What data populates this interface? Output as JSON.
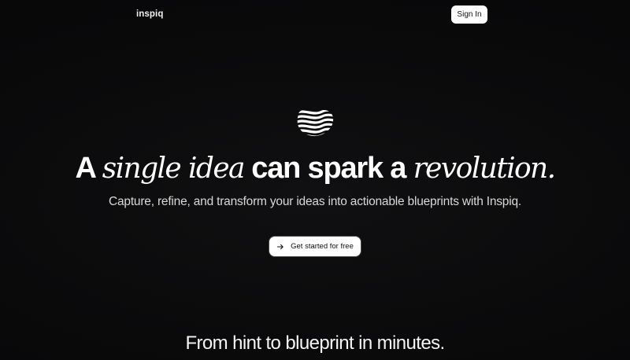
{
  "header": {
    "brand": "inspiq",
    "signin_label": "Sign In"
  },
  "hero": {
    "logo_icon": "wave-ribbon-icon",
    "headline": {
      "part1": "A ",
      "part2": "single idea",
      "part3": " can spark a ",
      "part4": "revolution."
    },
    "subtitle": "Capture, refine, and transform your ideas into actionable blueprints with Inspiq.",
    "cta_label": "Get started for free",
    "cta_icon": "arrow-right-icon"
  },
  "section": {
    "title": "From hint to blueprint in minutes."
  },
  "colors": {
    "background": "#09090a",
    "text": "#ffffff",
    "button_bg": "#ffffff",
    "button_text": "#111111"
  }
}
